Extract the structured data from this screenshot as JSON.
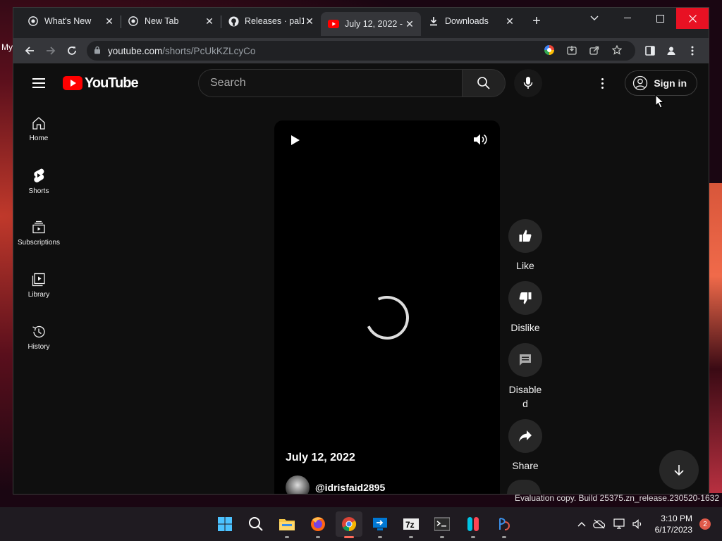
{
  "desktop": {
    "left_text": "My"
  },
  "tabs": [
    {
      "title": "What's New",
      "icon": "chrome-icon"
    },
    {
      "title": "New Tab",
      "icon": "chrome-icon"
    },
    {
      "title": "Releases · pal1",
      "icon": "github-icon"
    },
    {
      "title": "July 12, 2022 -",
      "icon": "youtube-icon",
      "active": true
    },
    {
      "title": "Downloads",
      "icon": "download-icon"
    }
  ],
  "tab_close": "✕",
  "newtab": "+",
  "window_controls": {
    "minimize": "—",
    "maximize": "☐",
    "close": "✕",
    "dropdown": "⌄"
  },
  "omnibox": {
    "host": "youtube.com",
    "path": "/shorts/PcUkKZLcyCo"
  },
  "youtube": {
    "logo": "YouTube",
    "search_placeholder": "Search",
    "signin": "Sign in",
    "nav": [
      {
        "label": "Home",
        "icon": "home-icon"
      },
      {
        "label": "Shorts",
        "icon": "shorts-icon"
      },
      {
        "label": "Subscriptions",
        "icon": "subscriptions-icon"
      },
      {
        "label": "Library",
        "icon": "library-icon"
      },
      {
        "label": "History",
        "icon": "history-icon"
      }
    ],
    "video": {
      "title": "July 12, 2022",
      "channel": "@idrisfaid2895"
    },
    "actions": {
      "like": "Like",
      "dislike": "Dislike",
      "comments": "Disabled",
      "share": "Share"
    }
  },
  "watermark": "Evaluation copy. Build 25375.zn_release.230520-1632",
  "taskbar": {
    "time": "3:10 PM",
    "date": "6/17/2023",
    "notifications": "2",
    "apps": [
      "start-icon",
      "search-icon",
      "file-explorer-icon",
      "firefox-icon",
      "chrome-icon",
      "remote-desktop-icon",
      "7zip-icon",
      "terminal-icon",
      "switch-icon",
      "app-icon"
    ]
  },
  "colors": {
    "youtube_red": "#ff0000",
    "close_red": "#e81123",
    "bg": "#0f0f0f"
  }
}
